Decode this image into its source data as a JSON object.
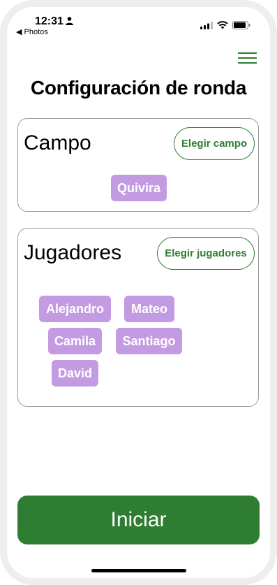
{
  "status_bar": {
    "time": "12:31",
    "back_label": "◀ Photos"
  },
  "header": {
    "title": "Configuración de ronda"
  },
  "field_card": {
    "title": "Campo",
    "choose_label": "Elegir campo",
    "chips": [
      "Quivira"
    ]
  },
  "players_card": {
    "title": "Jugadores",
    "choose_label": "Elegir jugadores",
    "chips": [
      "Alejandro",
      "Mateo",
      "Camila",
      "Santiago",
      "David"
    ]
  },
  "footer": {
    "start_label": "Iniciar"
  },
  "colors": {
    "accent": "#2e7d32",
    "chip": "#c39be3"
  }
}
